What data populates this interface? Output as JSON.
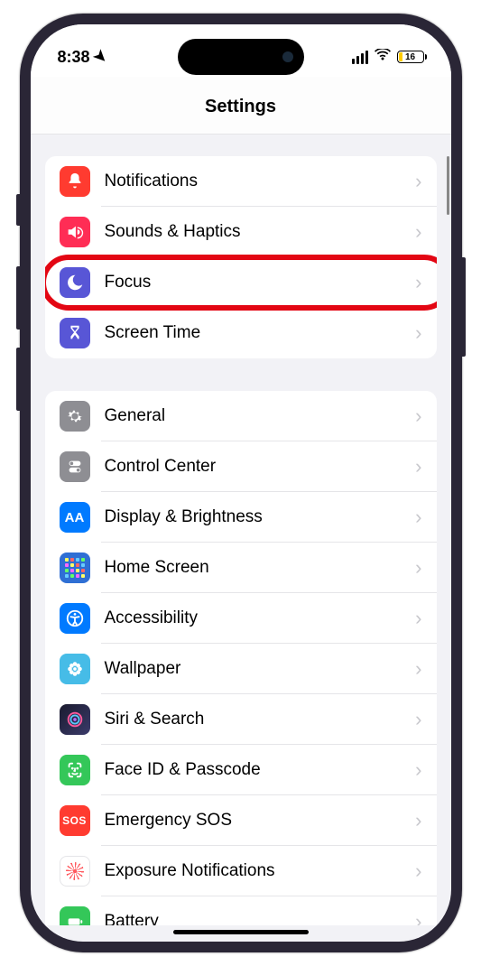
{
  "status": {
    "time": "8:38",
    "battery_percent": "16"
  },
  "header": {
    "title": "Settings"
  },
  "section1": [
    {
      "key": "notifications",
      "label": "Notifications",
      "icon": "bell-icon",
      "bg": "bg-red"
    },
    {
      "key": "sounds",
      "label": "Sounds & Haptics",
      "icon": "speaker-icon",
      "bg": "bg-pink"
    },
    {
      "key": "focus",
      "label": "Focus",
      "icon": "moon-icon",
      "bg": "bg-indigo",
      "highlighted": true
    },
    {
      "key": "screentime",
      "label": "Screen Time",
      "icon": "hourglass-icon",
      "bg": "bg-indigo"
    }
  ],
  "section2": [
    {
      "key": "general",
      "label": "General",
      "icon": "gear-icon",
      "bg": "bg-gray"
    },
    {
      "key": "controlcenter",
      "label": "Control Center",
      "icon": "switches-icon",
      "bg": "bg-gray"
    },
    {
      "key": "display",
      "label": "Display & Brightness",
      "icon": "text-size-icon",
      "bg": "bg-blue"
    },
    {
      "key": "homescreen",
      "label": "Home Screen",
      "icon": "home-grid-icon",
      "bg": "bg-multiblue"
    },
    {
      "key": "accessibility",
      "label": "Accessibility",
      "icon": "accessibility-icon",
      "bg": "bg-blue"
    },
    {
      "key": "wallpaper",
      "label": "Wallpaper",
      "icon": "flower-icon",
      "bg": "bg-cyan"
    },
    {
      "key": "siri",
      "label": "Siri & Search",
      "icon": "siri-icon",
      "bg": "bg-siri"
    },
    {
      "key": "faceid",
      "label": "Face ID & Passcode",
      "icon": "face-icon",
      "bg": "bg-green"
    },
    {
      "key": "sos",
      "label": "Emergency SOS",
      "icon": "sos-icon",
      "bg": "bg-sos"
    },
    {
      "key": "exposure",
      "label": "Exposure Notifications",
      "icon": "exposure-icon",
      "bg": "bg-white"
    },
    {
      "key": "battery",
      "label": "Battery",
      "icon": "battery-icon",
      "bg": "bg-green"
    }
  ]
}
